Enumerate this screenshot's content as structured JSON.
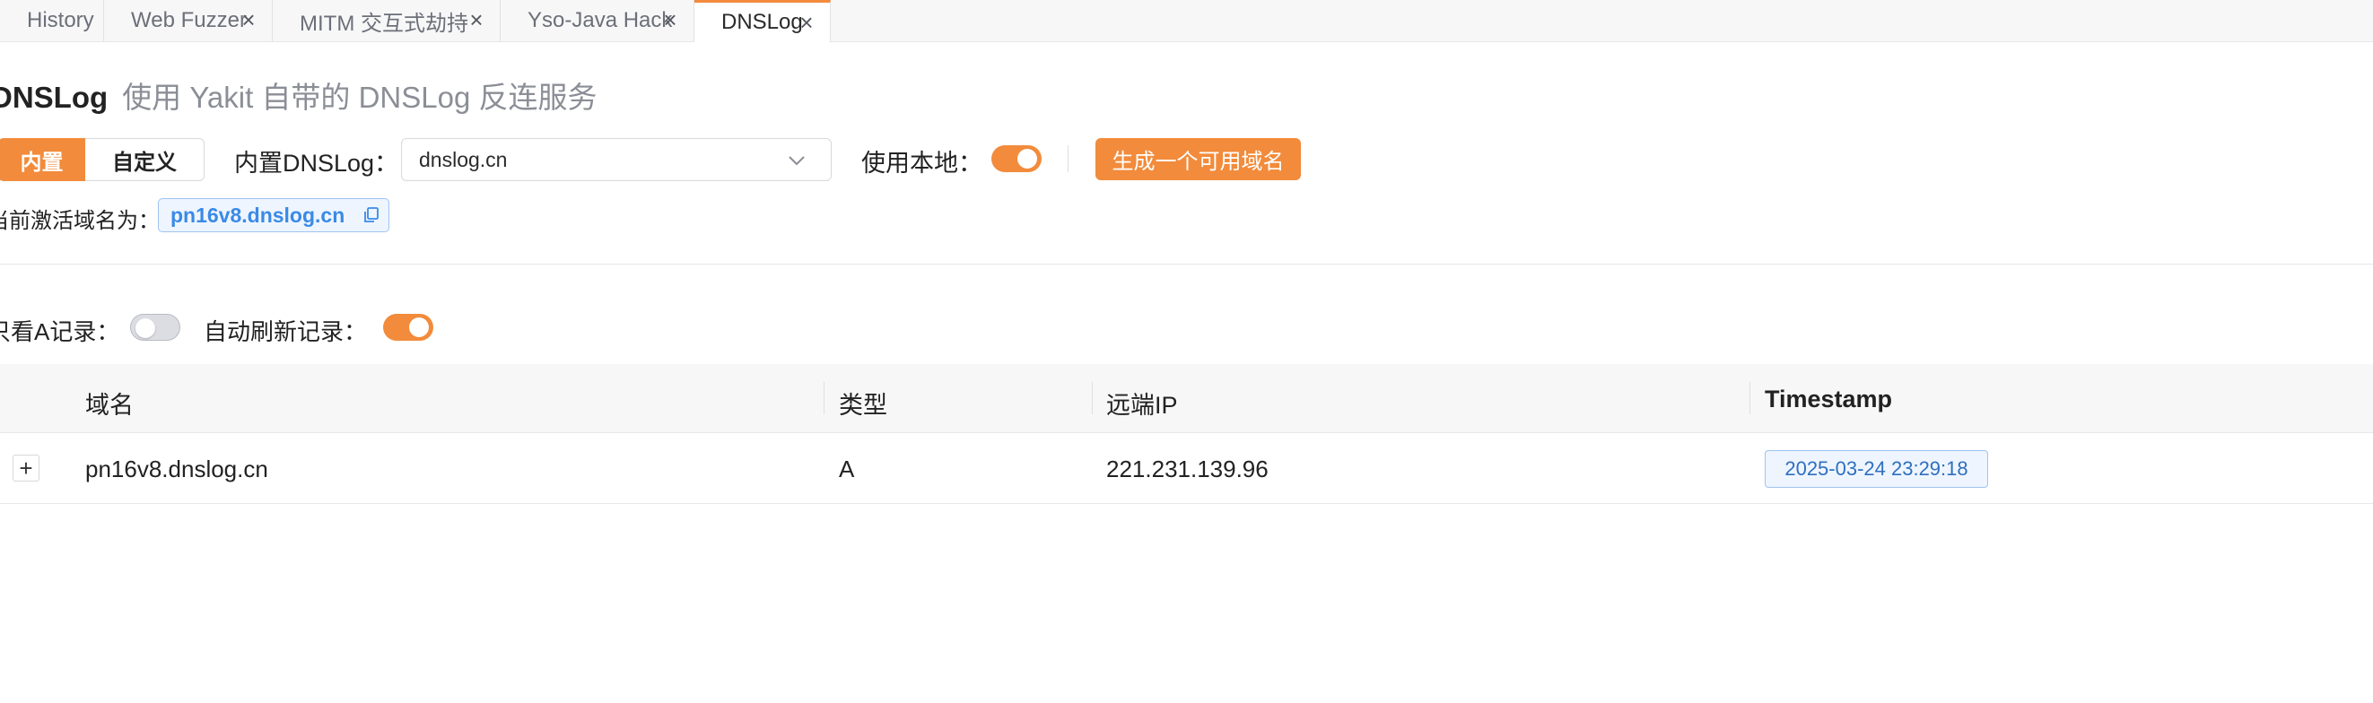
{
  "tabs": [
    {
      "label": "History",
      "closable": false
    },
    {
      "label": "Web Fuzzer",
      "closable": true
    },
    {
      "label": "MITM 交互式劫持",
      "closable": true
    },
    {
      "label": "Yso-Java Hack",
      "closable": true
    },
    {
      "label": "DNSLog",
      "closable": true,
      "active": true
    }
  ],
  "header": {
    "title": "DNSLog",
    "subtitle": "使用 Yakit 自带的 DNSLog 反连服务"
  },
  "mode": {
    "builtin_label": "内置",
    "custom_label": "自定义",
    "selected": "内置"
  },
  "builtin_dnslog": {
    "label": "内置DNSLog：",
    "value": "dnslog.cn"
  },
  "use_local": {
    "label": "使用本地：",
    "enabled": true
  },
  "generate_button": "生成一个可用域名",
  "active_domain": {
    "label": "当前激活域名为：",
    "value": "pn16v8.dnslog.cn"
  },
  "filters": {
    "only_a_label": "只看A记录：",
    "only_a_enabled": false,
    "auto_refresh_label": "自动刷新记录：",
    "auto_refresh_enabled": true
  },
  "table": {
    "columns": [
      "域名",
      "类型",
      "远端IP",
      "Timestamp"
    ],
    "rows": [
      {
        "domain": "pn16v8.dnslog.cn",
        "type": "A",
        "ip": "221.231.139.96",
        "timestamp": "2025-03-24 23:29:18"
      }
    ]
  },
  "colors": {
    "accent": "#f28b3b",
    "tag_blue": "#3a8ae6"
  },
  "icons": {
    "tab_close": "close-icon",
    "select_arrow": "chevron-down-icon",
    "copy": "copy-icon",
    "row_expand": "plus-icon"
  }
}
